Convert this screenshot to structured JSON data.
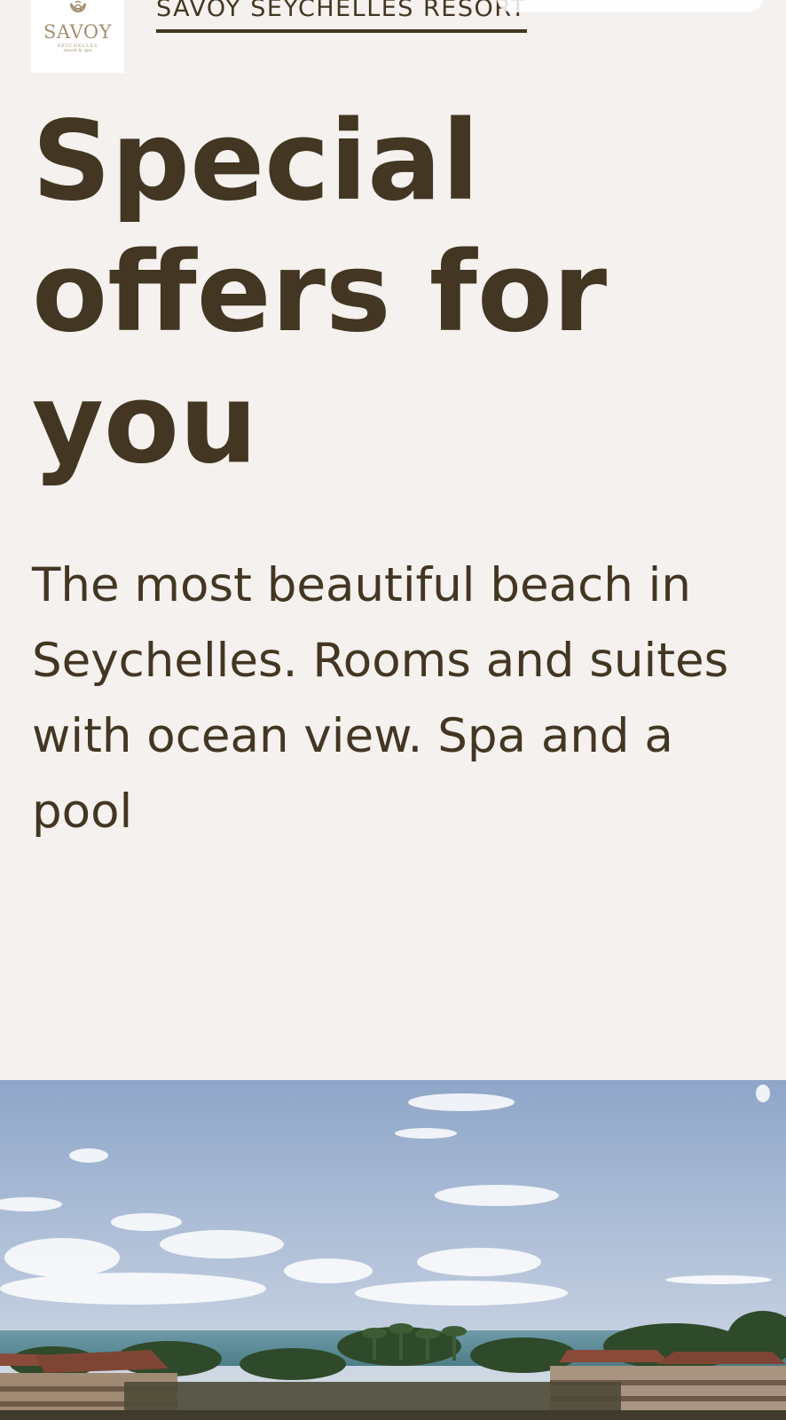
{
  "header": {
    "logo": {
      "name": "SAVOY",
      "subline": "SEYCHELLES",
      "subline2": "resort & spa"
    },
    "brand_link": "SAVOY SEYCHELLES RESORT"
  },
  "hero": {
    "title": "Special offers for you",
    "description": "The most beautiful beach in Seychelles. Rooms and suites with ocean view. Spa and a pool"
  },
  "colors": {
    "background": "#f4f1ee",
    "text": "#433622",
    "logo_gold": "#a2916f"
  },
  "icons": {
    "logo_emblem": "savoy-seahorse-emblem-icon"
  }
}
